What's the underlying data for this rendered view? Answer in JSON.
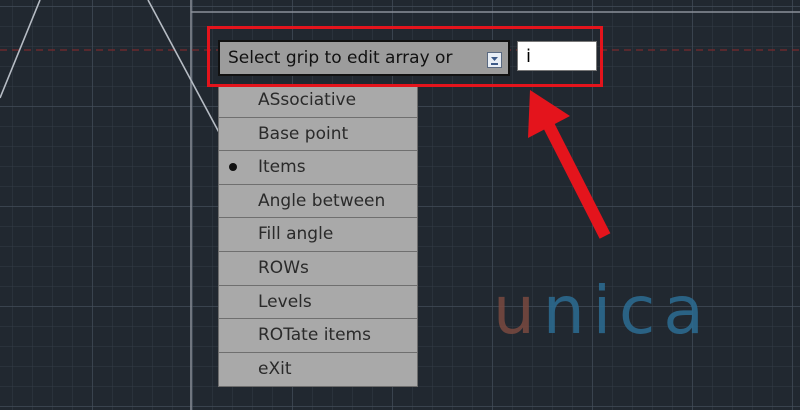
{
  "command_prompt": {
    "text": "Select grip to edit array or",
    "options_button_icon": "dropdown-arrow-icon"
  },
  "input": {
    "value": "i"
  },
  "option_menu": {
    "items": [
      {
        "label": "ASsociative",
        "selected": false
      },
      {
        "label": "Base point",
        "selected": false
      },
      {
        "label": "Items",
        "selected": true
      },
      {
        "label": "Angle between",
        "selected": false
      },
      {
        "label": "Fill angle",
        "selected": false
      },
      {
        "label": "ROWs",
        "selected": false
      },
      {
        "label": "Levels",
        "selected": false
      },
      {
        "label": "ROTate items",
        "selected": false
      },
      {
        "label": "eXit",
        "selected": false
      }
    ]
  },
  "annotation": {
    "highlight_color": "#e4141c",
    "arrow_icon": "red-arrow-icon"
  },
  "watermark": {
    "letters": [
      {
        "char": "u",
        "color": "#7a4a40"
      },
      {
        "char": "n",
        "color": "#2c6d93"
      },
      {
        "char": "i",
        "color": "#2c6d93"
      },
      {
        "char": "c",
        "color": "#2c6d93"
      },
      {
        "char": "a",
        "color": "#2c6d93"
      }
    ]
  },
  "colors": {
    "canvas_background": "#212830",
    "menu_background": "#a9a9a9",
    "prompt_background": "#9c9c9c"
  }
}
